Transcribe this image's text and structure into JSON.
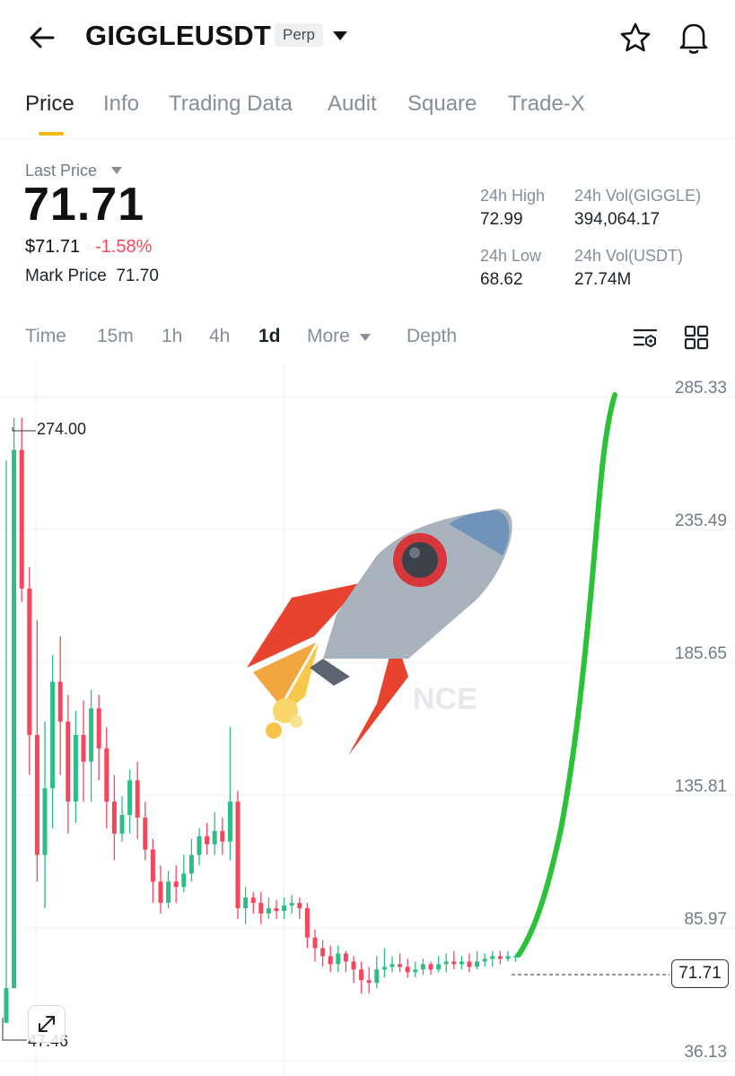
{
  "header": {
    "symbol": "GIGGLEUSDT",
    "badge": "Perp",
    "icons": [
      "back-arrow-icon",
      "caret-down-icon",
      "star-icon",
      "bell-icon"
    ]
  },
  "tabs": [
    "Price",
    "Info",
    "Trading Data",
    "Audit",
    "Square",
    "Trade-X"
  ],
  "active_tab": "Price",
  "accent_color": "#f0b90b",
  "up_color": "#2ebd85",
  "down_color": "#f6465d",
  "price_panel": {
    "last_price_label": "Last Price",
    "last_price": "71.71",
    "usd_price": "$71.71",
    "change": "-1.58%",
    "mark_price_label": "Mark Price",
    "mark_price": "71.70"
  },
  "stats": {
    "high_label": "24h High",
    "high": "72.99",
    "vol_base_label": "24h Vol(GIGGLE)",
    "vol_base": "394,064.17",
    "low_label": "24h Low",
    "low": "68.62",
    "vol_quote_label": "24h Vol(USDT)",
    "vol_quote": "27.74M"
  },
  "timeframes": [
    "Time",
    "15m",
    "1h",
    "4h",
    "1d",
    "More",
    "Depth"
  ],
  "selected_timeframe": "1d",
  "chart_data": {
    "type": "candlestick",
    "y_axis_labels": [
      "285.33",
      "235.49",
      "185.65",
      "135.81",
      "85.97",
      "36.13"
    ],
    "high_label": "274.00",
    "low_label": "47.46",
    "current_price": "71.71",
    "watermark": "NCE",
    "ylim": [
      36.13,
      285.33
    ],
    "candles": [
      [
        47,
        60,
        47,
        258
      ],
      [
        60,
        262,
        60,
        274
      ],
      [
        262,
        210,
        205,
        274
      ],
      [
        210,
        155,
        140,
        218
      ],
      [
        155,
        110,
        100,
        198
      ],
      [
        110,
        135,
        90,
        160
      ],
      [
        135,
        175,
        120,
        185
      ],
      [
        175,
        160,
        140,
        192
      ],
      [
        160,
        130,
        118,
        170
      ],
      [
        130,
        155,
        122,
        164
      ],
      [
        155,
        145,
        130,
        168
      ],
      [
        145,
        165,
        130,
        172
      ],
      [
        165,
        150,
        138,
        170
      ],
      [
        150,
        130,
        120,
        158
      ],
      [
        130,
        118,
        108,
        140
      ],
      [
        118,
        125,
        115,
        132
      ],
      [
        125,
        138,
        118,
        142
      ],
      [
        138,
        124,
        116,
        145
      ],
      [
        124,
        112,
        108,
        130
      ],
      [
        112,
        100,
        92,
        116
      ],
      [
        100,
        92,
        88,
        106
      ],
      [
        92,
        100,
        90,
        104
      ],
      [
        100,
        98,
        92,
        106
      ],
      [
        98,
        103,
        96,
        110
      ],
      [
        103,
        110,
        100,
        116
      ],
      [
        110,
        117,
        106,
        120
      ],
      [
        117,
        114,
        110,
        122
      ],
      [
        114,
        119,
        110,
        126
      ],
      [
        119,
        115,
        110,
        124
      ],
      [
        115,
        130,
        108,
        158
      ],
      [
        130,
        90,
        86,
        134
      ],
      [
        90,
        94,
        84,
        98
      ],
      [
        94,
        92,
        88,
        96
      ],
      [
        92,
        88,
        84,
        96
      ],
      [
        88,
        90,
        86,
        94
      ],
      [
        90,
        89,
        86,
        93
      ],
      [
        89,
        91,
        86,
        94
      ],
      [
        91,
        92,
        88,
        95
      ],
      [
        92,
        90,
        86,
        94
      ],
      [
        90,
        79,
        75,
        92
      ],
      [
        79,
        75,
        70,
        82
      ],
      [
        75,
        72,
        68,
        78
      ],
      [
        72,
        69,
        66,
        76
      ],
      [
        69,
        73,
        66,
        76
      ],
      [
        73,
        70,
        66,
        74
      ],
      [
        70,
        67,
        62,
        72
      ],
      [
        67,
        63,
        58,
        70
      ],
      [
        63,
        62,
        58,
        68
      ],
      [
        62,
        67,
        60,
        72
      ],
      [
        67,
        68,
        64,
        75
      ],
      [
        68,
        69,
        66,
        72
      ],
      [
        69,
        68,
        66,
        73
      ],
      [
        68,
        66,
        64,
        71
      ],
      [
        66,
        67,
        64,
        70
      ],
      [
        67,
        69,
        65,
        71
      ],
      [
        69,
        67,
        65,
        70
      ],
      [
        67,
        69,
        66,
        72
      ],
      [
        69,
        70,
        66,
        73
      ],
      [
        70,
        69,
        67,
        74
      ],
      [
        69,
        70,
        67,
        72
      ],
      [
        70,
        68,
        66,
        73
      ],
      [
        68,
        70,
        67,
        74
      ],
      [
        70,
        71,
        68,
        73
      ],
      [
        71,
        72,
        68,
        74
      ],
      [
        72,
        71,
        69,
        74
      ],
      [
        71,
        72,
        70,
        74
      ],
      [
        72,
        72,
        70,
        73
      ]
    ]
  }
}
